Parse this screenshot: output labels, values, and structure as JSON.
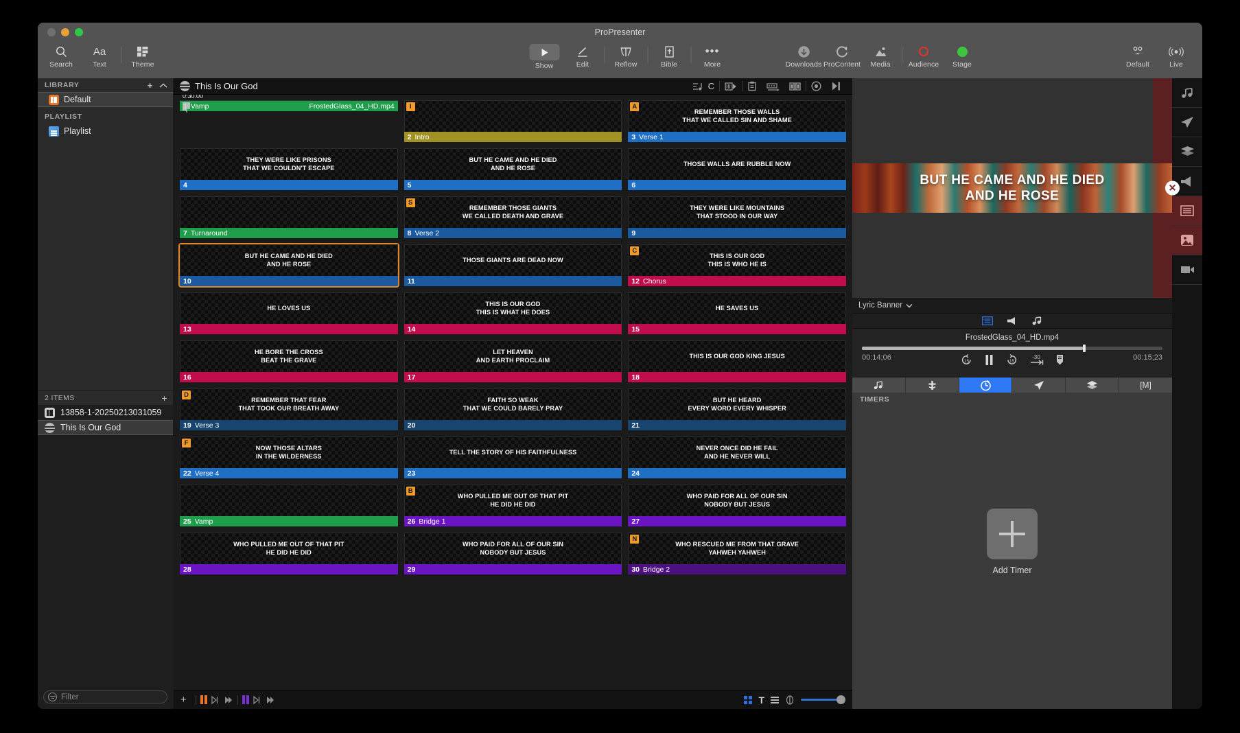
{
  "window": {
    "title": "ProPresenter"
  },
  "toolbar": {
    "left": [
      {
        "name": "search",
        "label": "Search"
      },
      {
        "name": "text",
        "label": "Text"
      },
      {
        "name": "theme",
        "label": "Theme"
      }
    ],
    "mid": [
      {
        "name": "show",
        "label": "Show"
      },
      {
        "name": "edit",
        "label": "Edit"
      },
      {
        "name": "reflow",
        "label": "Reflow"
      },
      {
        "name": "bible",
        "label": "Bible"
      },
      {
        "name": "more",
        "label": "More"
      }
    ],
    "right": [
      {
        "name": "downloads",
        "label": "Downloads"
      },
      {
        "name": "procontent",
        "label": "ProContent"
      },
      {
        "name": "media",
        "label": "Media"
      },
      {
        "name": "audience",
        "label": "Audience"
      },
      {
        "name": "stage",
        "label": "Stage"
      }
    ],
    "far_right": [
      {
        "name": "default",
        "label": "Default"
      },
      {
        "name": "live",
        "label": "Live"
      }
    ]
  },
  "sidebar": {
    "library_header": "LIBRARY",
    "library_items": [
      {
        "label": "Default",
        "selected": true
      }
    ],
    "playlist_header": "PLAYLIST",
    "playlist_items": [
      {
        "label": "Playlist",
        "selected": false
      }
    ],
    "items_count_label": "2 ITEMS",
    "items": [
      {
        "label": "13858-1-20250213031059",
        "icon": "library-icon",
        "selected": false
      },
      {
        "label": "This Is Our God",
        "icon": "document-icon",
        "selected": true
      }
    ],
    "filter_placeholder": "Filter"
  },
  "document": {
    "title": "This Is Our God",
    "header_icons": [
      "music-arrange-icon",
      "capo-c-icon",
      "slide-transition-icon",
      "clipboard-icon",
      "timeline-icon",
      "compare-icon",
      "record-icon",
      "next-icon"
    ],
    "capo_label": "C"
  },
  "slides": [
    {
      "num": "1",
      "group": "Vamp",
      "color": "#1e9e4a",
      "text": "",
      "hotkey": "",
      "video": true,
      "duration": "0:30.00",
      "file": "FrostedGlass_04_HD.mp4",
      "selected": false
    },
    {
      "num": "2",
      "group": "Intro",
      "color": "#a09225",
      "text": "",
      "hotkey": "I",
      "video": false,
      "selected": false
    },
    {
      "num": "3",
      "group": "Verse 1",
      "color": "#1f6fc4",
      "text": "REMEMBER THOSE WALLS\nTHAT WE CALLED SIN AND SHAME",
      "hotkey": "A",
      "video": false,
      "selected": false
    },
    {
      "num": "4",
      "group": "",
      "color": "#1f6fc4",
      "text": "THEY WERE LIKE PRISONS\nTHAT WE COULDN'T ESCAPE",
      "hotkey": "",
      "video": false,
      "selected": false
    },
    {
      "num": "5",
      "group": "",
      "color": "#1f6fc4",
      "text": "BUT HE CAME AND HE DIED\nAND HE ROSE",
      "hotkey": "",
      "video": false,
      "selected": false
    },
    {
      "num": "6",
      "group": "",
      "color": "#1f6fc4",
      "text": "THOSE WALLS ARE RUBBLE NOW",
      "hotkey": "",
      "video": false,
      "selected": false
    },
    {
      "num": "7",
      "group": "Turnaround",
      "color": "#1e9e4a",
      "text": "",
      "hotkey": "",
      "video": false,
      "selected": false
    },
    {
      "num": "8",
      "group": "Verse 2",
      "color": "#1b5a9e",
      "text": "REMEMBER THOSE GIANTS\nWE CALLED DEATH AND GRAVE",
      "hotkey": "S",
      "video": false,
      "selected": false
    },
    {
      "num": "9",
      "group": "",
      "color": "#1b5a9e",
      "text": "THEY WERE LIKE MOUNTAINS\nTHAT STOOD IN OUR WAY",
      "hotkey": "",
      "video": false,
      "selected": false
    },
    {
      "num": "10",
      "group": "",
      "color": "#1b5a9e",
      "text": "BUT HE CAME AND HE DIED\nAND HE ROSE",
      "hotkey": "",
      "video": false,
      "selected": true
    },
    {
      "num": "11",
      "group": "",
      "color": "#1b5a9e",
      "text": "THOSE GIANTS ARE DEAD NOW",
      "hotkey": "",
      "video": false,
      "selected": false
    },
    {
      "num": "12",
      "group": "Chorus",
      "color": "#c10d4e",
      "text": "THIS IS OUR GOD\nTHIS IS WHO HE IS",
      "hotkey": "C",
      "video": false,
      "selected": false
    },
    {
      "num": "13",
      "group": "",
      "color": "#c10d4e",
      "text": "HE LOVES US",
      "hotkey": "",
      "video": false,
      "selected": false
    },
    {
      "num": "14",
      "group": "",
      "color": "#c10d4e",
      "text": "THIS IS OUR GOD\nTHIS IS WHAT HE DOES",
      "hotkey": "",
      "video": false,
      "selected": false
    },
    {
      "num": "15",
      "group": "",
      "color": "#c10d4e",
      "text": "HE SAVES US",
      "hotkey": "",
      "video": false,
      "selected": false
    },
    {
      "num": "16",
      "group": "",
      "color": "#c10d4e",
      "text": "HE BORE THE CROSS\nBEAT THE GRAVE",
      "hotkey": "",
      "video": false,
      "selected": false
    },
    {
      "num": "17",
      "group": "",
      "color": "#c10d4e",
      "text": "LET HEAVEN\nAND EARTH PROCLAIM",
      "hotkey": "",
      "video": false,
      "selected": false
    },
    {
      "num": "18",
      "group": "",
      "color": "#c10d4e",
      "text": "THIS IS OUR GOD KING JESUS",
      "hotkey": "",
      "video": false,
      "selected": false
    },
    {
      "num": "19",
      "group": "Verse 3",
      "color": "#17456f",
      "text": "REMEMBER THAT FEAR\nTHAT TOOK OUR BREATH AWAY",
      "hotkey": "D",
      "video": false,
      "selected": false
    },
    {
      "num": "20",
      "group": "",
      "color": "#17456f",
      "text": "FAITH SO WEAK\nTHAT WE COULD BARELY PRAY",
      "hotkey": "",
      "video": false,
      "selected": false
    },
    {
      "num": "21",
      "group": "",
      "color": "#17456f",
      "text": "BUT HE HEARD\nEVERY WORD EVERY WHISPER",
      "hotkey": "",
      "video": false,
      "selected": false
    },
    {
      "num": "22",
      "group": "Verse 4",
      "color": "#1f6fc4",
      "text": "NOW THOSE ALTARS\nIN THE WILDERNESS",
      "hotkey": "F",
      "video": false,
      "selected": false
    },
    {
      "num": "23",
      "group": "",
      "color": "#1f6fc4",
      "text": "TELL THE STORY OF HIS FAITHFULNESS",
      "hotkey": "",
      "video": false,
      "selected": false
    },
    {
      "num": "24",
      "group": "",
      "color": "#1f6fc4",
      "text": "NEVER ONCE DID HE FAIL\nAND HE NEVER WILL",
      "hotkey": "",
      "video": false,
      "selected": false
    },
    {
      "num": "25",
      "group": "Vamp",
      "color": "#1e9e4a",
      "text": "",
      "hotkey": "",
      "video": false,
      "selected": false
    },
    {
      "num": "26",
      "group": "Bridge 1",
      "color": "#6b14c4",
      "text": "WHO PULLED ME OUT OF THAT PIT\nHE DID HE DID",
      "hotkey": "B",
      "video": false,
      "selected": false
    },
    {
      "num": "27",
      "group": "",
      "color": "#6b14c4",
      "text": "WHO PAID FOR ALL OF OUR SIN\nNOBODY BUT JESUS",
      "hotkey": "",
      "video": false,
      "selected": false
    },
    {
      "num": "28",
      "group": "",
      "color": "#6b14c4",
      "text": "WHO PULLED ME OUT OF THAT PIT\nHE DID HE DID",
      "hotkey": "",
      "video": false,
      "selected": false
    },
    {
      "num": "29",
      "group": "",
      "color": "#6b14c4",
      "text": "WHO PAID FOR ALL OF OUR SIN\nNOBODY BUT JESUS",
      "hotkey": "",
      "video": false,
      "selected": false
    },
    {
      "num": "30",
      "group": "Bridge 2",
      "color": "#4d1080",
      "text": "WHO RESCUED ME FROM THAT GRAVE\nYAHWEH YAHWEH",
      "hotkey": "N",
      "video": false,
      "selected": false
    }
  ],
  "preview": {
    "banner_text": "BUT HE CAME AND HE DIED\nAND HE ROSE",
    "layer_label": "Lyric Banner",
    "tabs": [
      "slide-icon",
      "announcement-icon",
      "audio-icon"
    ]
  },
  "media_player": {
    "filename": "FrostedGlass_04_HD.mp4",
    "elapsed": "00:14;06",
    "remaining": "00:15;23",
    "progress_percent": 73.5,
    "controls": [
      "back-15-icon",
      "pause-icon",
      "forward-15-icon",
      "minus-30-icon",
      "marker-icon"
    ]
  },
  "bottom_panel": {
    "tabs": [
      {
        "name": "audio",
        "icon": "music-note-icon",
        "active": false
      },
      {
        "name": "props",
        "icon": "prop-icon",
        "active": false
      },
      {
        "name": "timers",
        "icon": "timer-icon",
        "active": true
      },
      {
        "name": "stage",
        "icon": "send-icon",
        "active": false
      },
      {
        "name": "layers",
        "icon": "layers-icon",
        "active": false
      },
      {
        "name": "macros",
        "icon": "macro-m-icon",
        "active": false
      }
    ],
    "section_title": "TIMERS",
    "add_label": "Add Timer"
  },
  "right_rail": [
    {
      "name": "audio",
      "icon": "music-note-icon",
      "highlighted": false
    },
    {
      "name": "stage",
      "icon": "send-icon",
      "highlighted": false
    },
    {
      "name": "layers",
      "icon": "layers-icon",
      "highlighted": false
    },
    {
      "name": "messages",
      "icon": "megaphone-icon",
      "highlighted": false
    },
    {
      "name": "banner",
      "icon": "banner-icon",
      "highlighted": true
    },
    {
      "name": "image",
      "icon": "image-icon",
      "highlighted": true
    },
    {
      "name": "video",
      "icon": "video-icon",
      "highlighted": false
    }
  ],
  "grid_toolbar": {
    "add_label": "+",
    "groups": [
      {
        "name": "orange-transition",
        "color": "#e8772c"
      },
      {
        "name": "purple-transition",
        "color": "#7b2fd8"
      }
    ]
  }
}
